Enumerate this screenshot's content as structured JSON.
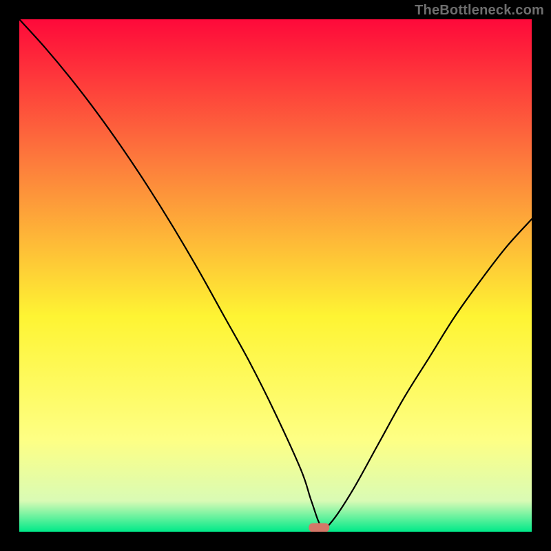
{
  "watermark": "TheBottleneck.com",
  "colors": {
    "gradient_top": "#fe093a",
    "gradient_mid_upper": "#fd7c3c",
    "gradient_mid": "#fef433",
    "gradient_lower": "#feff84",
    "gradient_near_bottom": "#d9fbb5",
    "gradient_bottom": "#00e989",
    "curve": "#000000",
    "marker": "#d47768",
    "frame": "#000000"
  },
  "chart_data": {
    "type": "line",
    "title": "",
    "xlabel": "",
    "ylabel": "",
    "xlim": [
      0,
      100
    ],
    "ylim": [
      0,
      100
    ],
    "grid": false,
    "legend": false,
    "series": [
      {
        "name": "bottleneck-curve",
        "x": [
          0,
          5,
          10,
          15,
          20,
          25,
          30,
          35,
          40,
          45,
          50,
          55,
          57,
          59,
          61,
          65,
          70,
          75,
          80,
          85,
          90,
          95,
          100
        ],
        "y": [
          100,
          94.5,
          88.5,
          82,
          75,
          67.5,
          59.5,
          51,
          42,
          33,
          23,
          12,
          6,
          1,
          2,
          8,
          17,
          26,
          34,
          42,
          49,
          55.5,
          61
        ]
      }
    ],
    "annotations": [
      {
        "name": "optimal-marker",
        "x": 58.5,
        "y": 0.8,
        "shape": "rounded-rect"
      }
    ]
  }
}
